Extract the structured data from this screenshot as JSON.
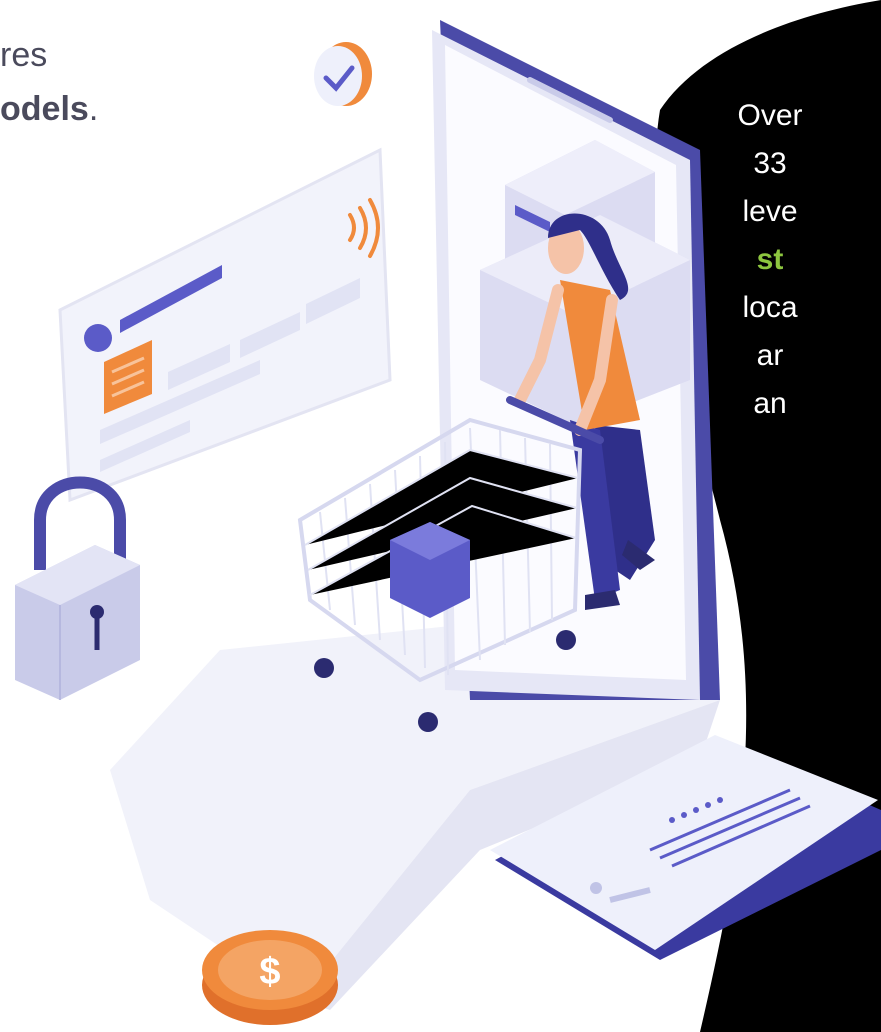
{
  "left_text": {
    "line1": "res",
    "line2_bold": "odels",
    "line2_punct": "."
  },
  "right_text": {
    "lines": [
      "Over",
      "33",
      "leve",
      "st",
      "loca",
      "ar",
      "an"
    ],
    "highlight_index": 3
  },
  "colors": {
    "primary": "#5b5bc8",
    "accent": "#f08a3c",
    "highlight": "#8dc63f",
    "panel": "#000000",
    "light": "#e8e9f7"
  },
  "icons": [
    "check-badge-icon",
    "contactless-icon",
    "padlock-icon",
    "shopping-cart-icon",
    "dollar-coin-icon",
    "card-chip-icon"
  ]
}
